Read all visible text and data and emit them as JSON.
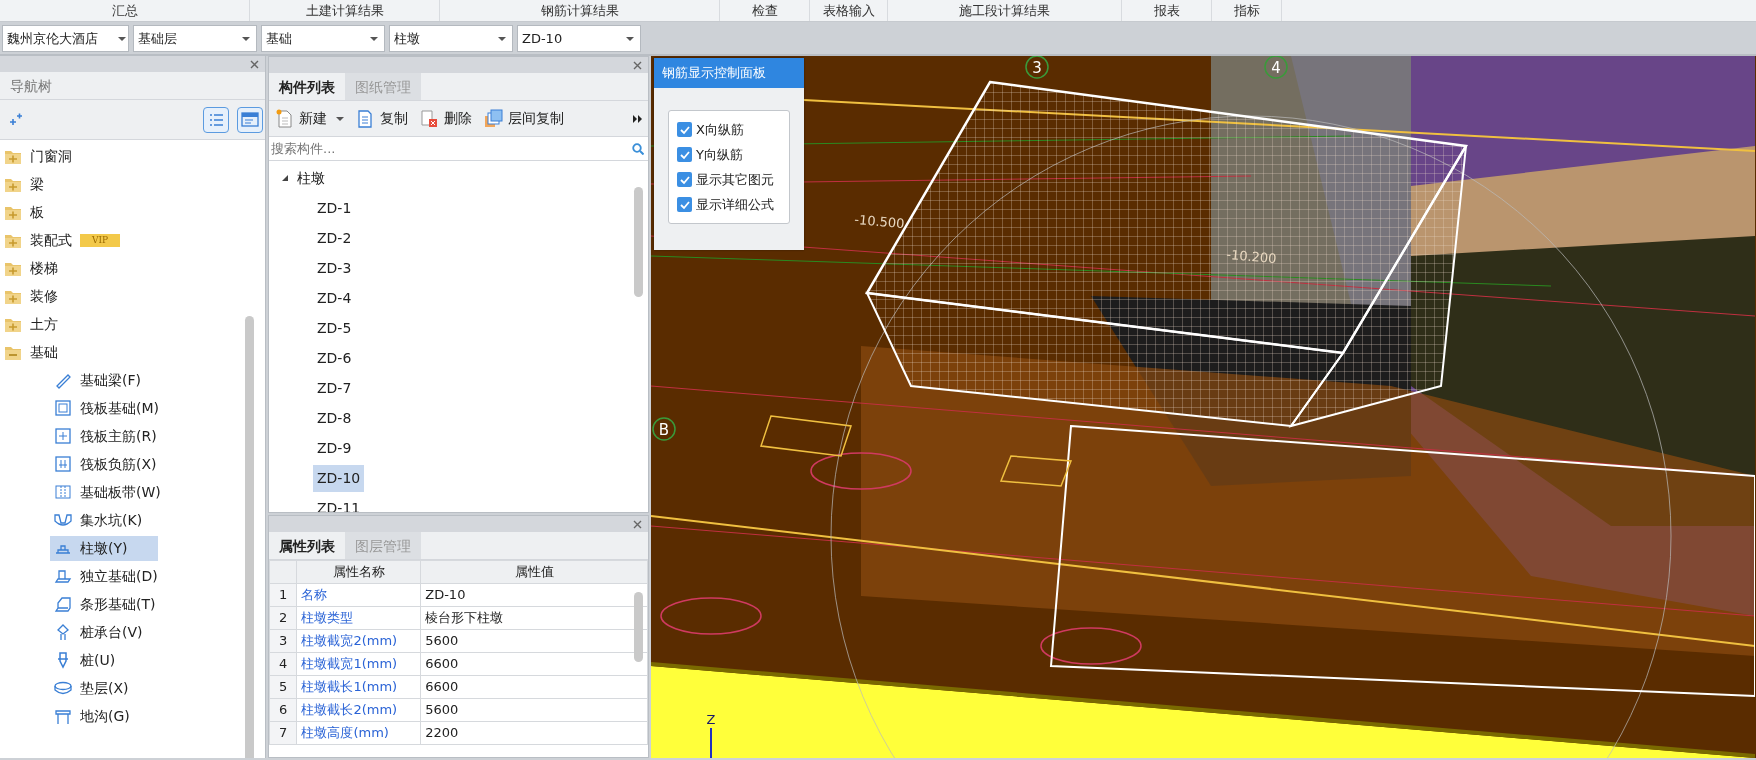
{
  "menu_bar": [
    {
      "label": "汇总"
    },
    {
      "label": "土建计算结果"
    },
    {
      "label": "钢筋计算结果"
    },
    {
      "label": "检查"
    },
    {
      "label": "表格输入"
    },
    {
      "label": "施工段计算结果"
    },
    {
      "label": "报表"
    },
    {
      "label": "指标"
    }
  ],
  "selectors": [
    {
      "value": "魏州京伦大酒店"
    },
    {
      "value": "基础层"
    },
    {
      "value": "基础"
    },
    {
      "value": "柱墩"
    },
    {
      "value": "ZD-10"
    }
  ],
  "nav_panel": {
    "title": "导航树",
    "items": [
      {
        "label": "门窗洞",
        "expanded": false
      },
      {
        "label": "梁",
        "expanded": false
      },
      {
        "label": "板",
        "expanded": false
      },
      {
        "label": "装配式",
        "expanded": false,
        "badge": "VIP"
      },
      {
        "label": "楼梯",
        "expanded": false
      },
      {
        "label": "装修",
        "expanded": false
      },
      {
        "label": "土方",
        "expanded": false
      },
      {
        "label": "基础",
        "expanded": true,
        "children": [
          {
            "label": "基础梁(F)",
            "selected": false
          },
          {
            "label": "筏板基础(M)",
            "selected": false
          },
          {
            "label": "筏板主筋(R)",
            "selected": false
          },
          {
            "label": "筏板负筋(X)",
            "selected": false
          },
          {
            "label": "基础板带(W)",
            "selected": false
          },
          {
            "label": "集水坑(K)",
            "selected": false
          },
          {
            "label": "柱墩(Y)",
            "selected": true
          },
          {
            "label": "独立基础(D)",
            "selected": false
          },
          {
            "label": "条形基础(T)",
            "selected": false
          },
          {
            "label": "桩承台(V)",
            "selected": false
          },
          {
            "label": "桩(U)",
            "selected": false
          },
          {
            "label": "垫层(X)",
            "selected": false
          },
          {
            "label": "地沟(G)",
            "selected": false
          }
        ]
      }
    ]
  },
  "component_panel": {
    "tabs": [
      {
        "label": "构件列表",
        "selected": true
      },
      {
        "label": "图纸管理",
        "selected": false
      }
    ],
    "toolbar": [
      {
        "label": "新建",
        "dropdown": true
      },
      {
        "label": "复制",
        "dropdown": false
      },
      {
        "label": "删除",
        "dropdown": false
      },
      {
        "label": "层间复制",
        "dropdown": false
      }
    ],
    "search": {
      "placeholder": "搜索构件..."
    },
    "tree": {
      "label": "柱墩",
      "expanded": true,
      "children": [
        {
          "label": "ZD-1",
          "selected": false
        },
        {
          "label": "ZD-2",
          "selected": false
        },
        {
          "label": "ZD-3",
          "selected": false
        },
        {
          "label": "ZD-4",
          "selected": false
        },
        {
          "label": "ZD-5",
          "selected": false
        },
        {
          "label": "ZD-6",
          "selected": false
        },
        {
          "label": "ZD-7",
          "selected": false
        },
        {
          "label": "ZD-8",
          "selected": false
        },
        {
          "label": "ZD-9",
          "selected": false
        },
        {
          "label": "ZD-10",
          "selected": true
        },
        {
          "label": "ZD-11",
          "selected": false
        }
      ]
    }
  },
  "property_panel": {
    "tabs": [
      {
        "label": "属性列表",
        "selected": true
      },
      {
        "label": "图层管理",
        "selected": false
      }
    ],
    "columns": [
      "属性名称",
      "属性值"
    ],
    "rows": [
      {
        "index": "1",
        "name": "名称",
        "value": "ZD-10"
      },
      {
        "index": "2",
        "name": "柱墩类型",
        "value": "棱台形下柱墩"
      },
      {
        "index": "3",
        "name": "柱墩截宽2(mm)",
        "value": "5600"
      },
      {
        "index": "4",
        "name": "柱墩截宽1(mm)",
        "value": "6600"
      },
      {
        "index": "5",
        "name": "柱墩截长1(mm)",
        "value": "6600"
      },
      {
        "index": "6",
        "name": "柱墩截长2(mm)",
        "value": "5600"
      },
      {
        "index": "7",
        "name": "柱墩高度(mm)",
        "value": "2200"
      }
    ]
  },
  "rebar_panel": {
    "title": "钢筋显示控制面板",
    "options": [
      {
        "label": "X向纵筋",
        "checked": true
      },
      {
        "label": "Y向纵筋",
        "checked": true
      },
      {
        "label": "显示其它图元",
        "checked": true
      },
      {
        "label": "显示详细公式",
        "checked": true
      }
    ]
  },
  "viewport": {
    "axis_labels": [
      "3",
      "4",
      "B"
    ],
    "elevations": [
      "-10.500",
      "-10.200"
    ],
    "axis_z": "Z"
  }
}
